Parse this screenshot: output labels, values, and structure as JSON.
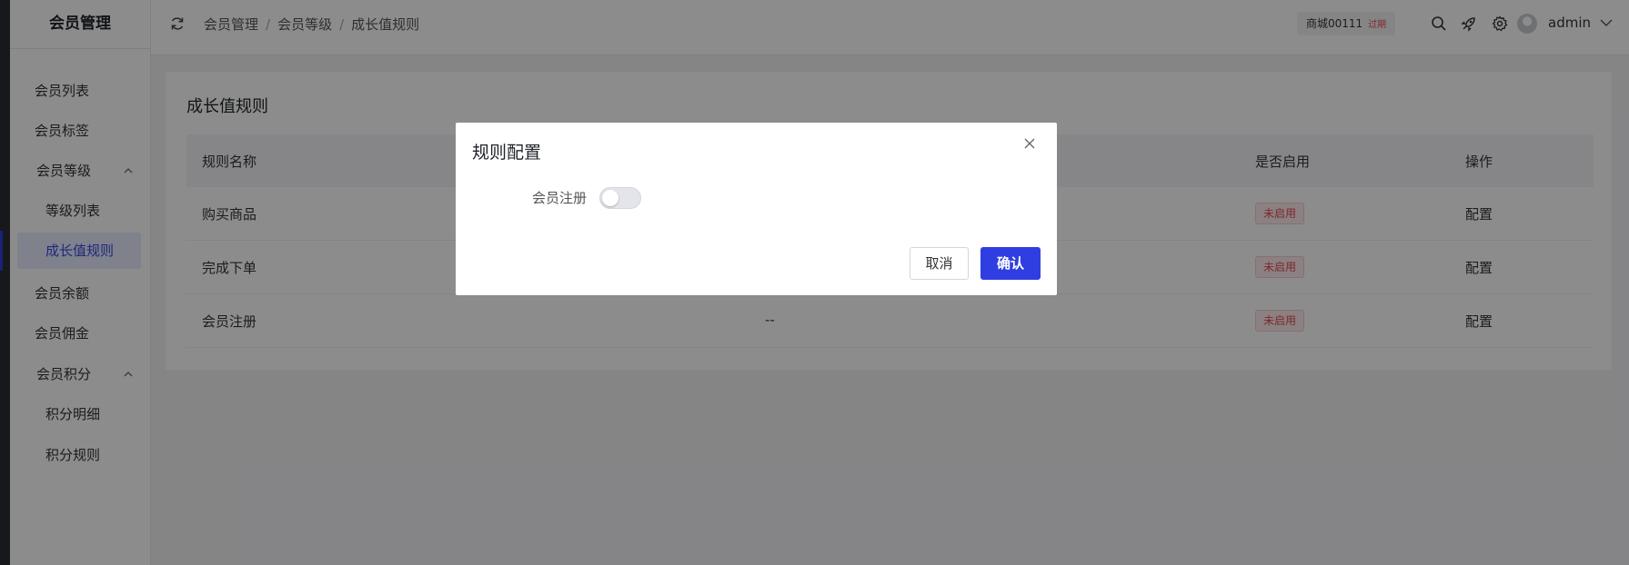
{
  "sidebar": {
    "title": "会员管理",
    "items": [
      {
        "label": "会员列表"
      },
      {
        "label": "会员标签"
      },
      {
        "label": "会员等级"
      },
      {
        "label": "等级列表"
      },
      {
        "label": "成长值规则"
      },
      {
        "label": "会员余额"
      },
      {
        "label": "会员佣金"
      },
      {
        "label": "会员积分"
      },
      {
        "label": "积分明细"
      },
      {
        "label": "积分规则"
      }
    ]
  },
  "header": {
    "breadcrumb": [
      "会员管理",
      "会员等级",
      "成长值规则"
    ],
    "breadcrumb_sep": "/",
    "shop_name": "商城00111",
    "shop_status": "过期",
    "username": "admin"
  },
  "main": {
    "title": "成长值规则",
    "columns": [
      "规则名称",
      "是否启用",
      "操作"
    ],
    "rows": [
      {
        "name": "购买商品",
        "middle": "",
        "status": "未启用",
        "action": "配置"
      },
      {
        "name": "完成下单",
        "middle": "",
        "status": "未启用",
        "action": "配置"
      },
      {
        "name": "会员注册",
        "middle": "--",
        "status": "未启用",
        "action": "配置"
      }
    ]
  },
  "modal": {
    "title": "规则配置",
    "field_label": "会员注册",
    "switch_on": false,
    "cancel_label": "取消",
    "ok_label": "确认"
  },
  "colors": {
    "accent": "#2f3ee0",
    "tag_red": "#e5484d",
    "overlay": "rgba(0,0,0,0.45)"
  },
  "icons": [
    "refresh-icon",
    "search-icon",
    "rocket-icon",
    "gear-icon",
    "avatar",
    "chevron-down-icon",
    "chevron-up-icon",
    "close-icon"
  ]
}
